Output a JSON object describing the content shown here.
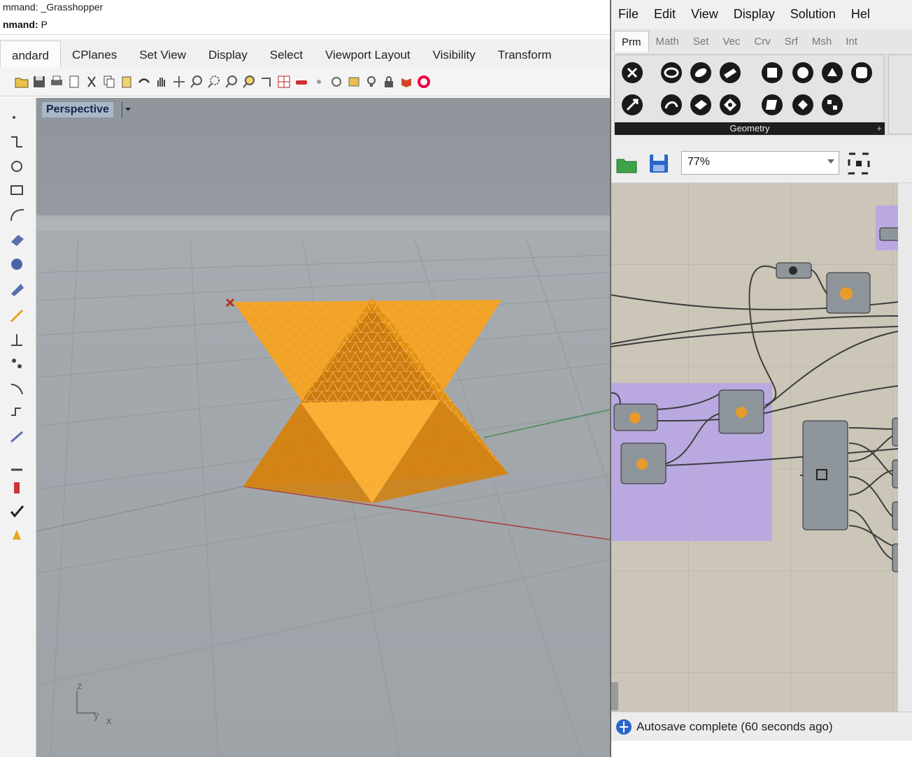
{
  "rhino": {
    "command_history": "mmand: _Grasshopper",
    "command_prompt_label": "nmand:",
    "command_prompt_value": "P",
    "tabs": [
      {
        "label": "andard",
        "active": true
      },
      {
        "label": "CPlanes"
      },
      {
        "label": "Set View"
      },
      {
        "label": "Display"
      },
      {
        "label": "Select"
      },
      {
        "label": "Viewport Layout"
      },
      {
        "label": "Visibility"
      },
      {
        "label": "Transform"
      }
    ],
    "viewport": {
      "title": "Perspective",
      "axis_z": "z",
      "axis_y": "y",
      "axis_x": "x",
      "object_color": "#f5a11f"
    }
  },
  "grasshopper": {
    "menu": [
      "File",
      "Edit",
      "View",
      "Display",
      "Solution",
      "Hel"
    ],
    "tabs": [
      {
        "label": "Prm",
        "active": true
      },
      {
        "label": "Math"
      },
      {
        "label": "Set"
      },
      {
        "label": "Vec"
      },
      {
        "label": "Crv"
      },
      {
        "label": "Srf"
      },
      {
        "label": "Msh"
      },
      {
        "label": "Int"
      }
    ],
    "ribbon_panel_label": "Geometry",
    "ribbon_panel_plus": "+",
    "zoom_value": "77%",
    "status_text": "Autosave complete (60 seconds ago)",
    "group_color": "#b7a3e6"
  }
}
